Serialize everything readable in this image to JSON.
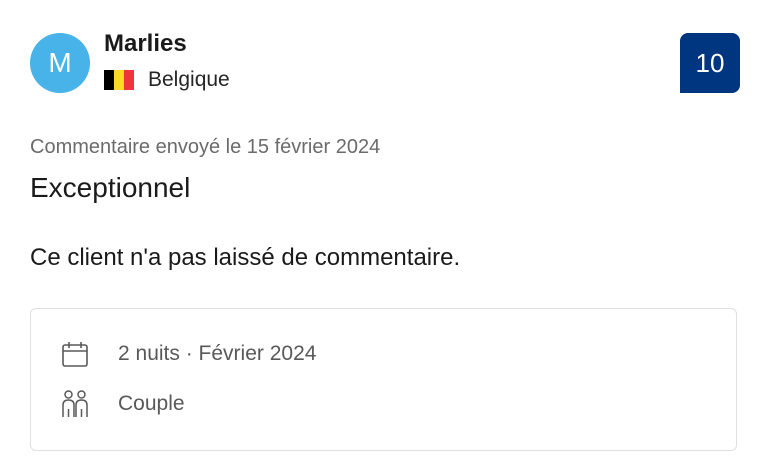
{
  "reviewer": {
    "initial": "M",
    "name": "Marlies",
    "country": "Belgique",
    "flag_colors": [
      "#000000",
      "#fdda24",
      "#ef3340"
    ],
    "avatar_color": "#47b3e8"
  },
  "score": {
    "value": "10",
    "color": "#003580"
  },
  "review": {
    "date_line": "Commentaire envoyé le 15 février 2024",
    "title": "Exceptionnel",
    "body": "Ce client n'a pas laissé de commentaire."
  },
  "stay": {
    "duration": {
      "icon": "calendar-icon",
      "text": "2 nuits · Février 2024"
    },
    "traveler_type": {
      "icon": "people-icon",
      "text": "Couple"
    }
  }
}
